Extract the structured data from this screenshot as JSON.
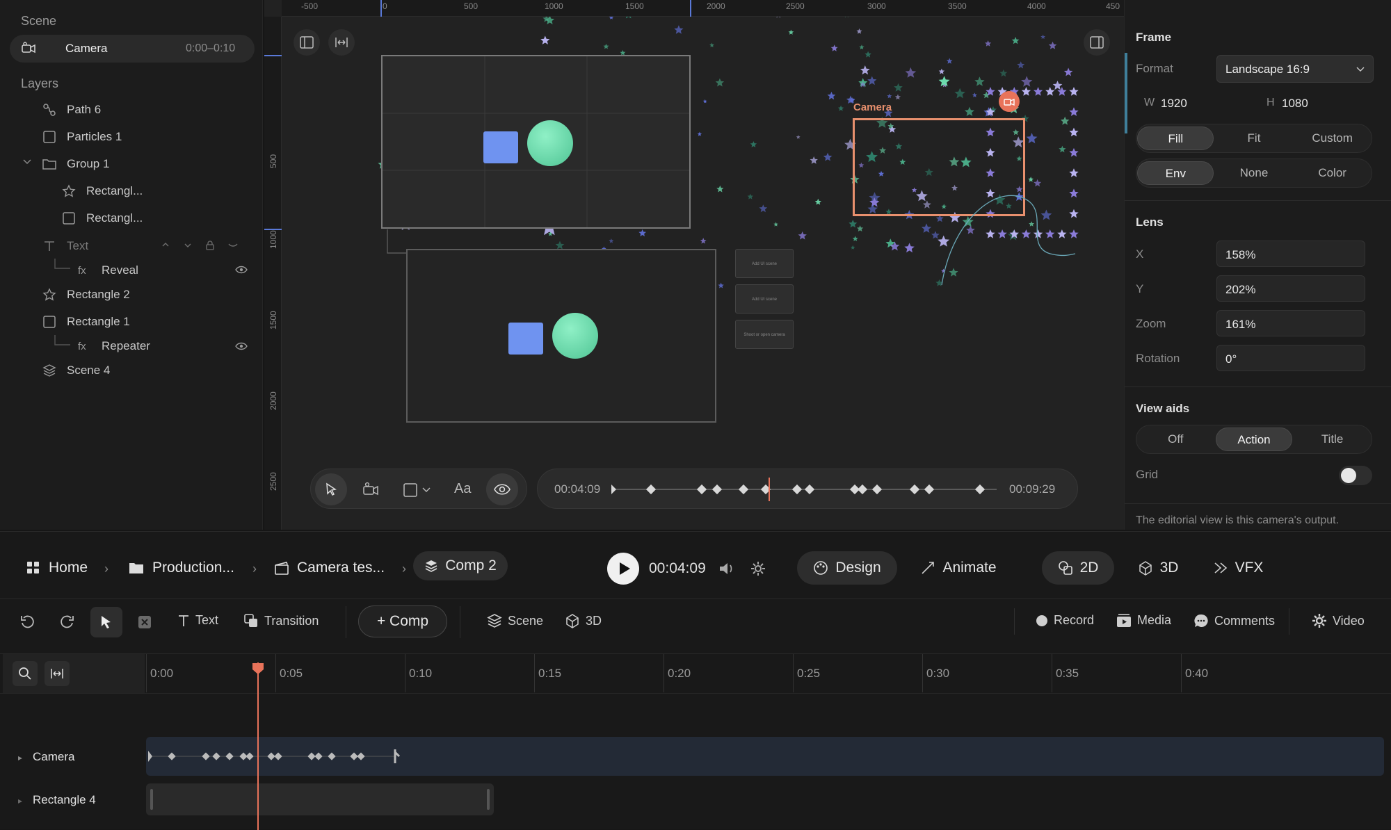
{
  "scene_panel": {
    "title": "Scene",
    "camera": {
      "label": "Camera",
      "range": "0:00–0:10"
    },
    "layers_title": "Layers",
    "layers": [
      {
        "label": "Path 6",
        "icon": "path-icon"
      },
      {
        "label": "Particles 1",
        "icon": "square-icon"
      },
      {
        "label": "Group 1",
        "icon": "folder-icon"
      },
      {
        "label": "Rectangl...",
        "icon": "star-icon"
      },
      {
        "label": "Rectangl...",
        "icon": "square-icon"
      },
      {
        "label": "Text",
        "icon": "text-icon"
      },
      {
        "label": "Reveal",
        "icon": "fx-icon"
      },
      {
        "label": "Rectangle 2",
        "icon": "star-icon"
      },
      {
        "label": "Rectangle 1",
        "icon": "square-icon"
      },
      {
        "label": "Repeater",
        "icon": "fx-icon"
      },
      {
        "label": "Scene 4",
        "icon": "stack-icon"
      }
    ],
    "fx_label": "fx"
  },
  "canvas": {
    "ruler_top": [
      "-500",
      "0",
      "500",
      "1000",
      "1500",
      "2000",
      "2500",
      "3000",
      "3500",
      "4000",
      "450"
    ],
    "ruler_left": [
      "500",
      "1000",
      "1500",
      "2000",
      "2500"
    ],
    "camera_label": "Camera",
    "thumb_text": [
      "Add UI scene",
      "Add UI scene",
      "Shoot or open camera"
    ],
    "playback": {
      "start": "00:04:09",
      "end": "00:09:29"
    }
  },
  "inspector": {
    "frame_title": "Frame",
    "format_label": "Format",
    "format_value": "Landscape 16:9",
    "w_label": "W",
    "w_value": "1920",
    "h_label": "H",
    "h_value": "1080",
    "fit_options": [
      "Fill",
      "Fit",
      "Custom"
    ],
    "fit_selected": "Fill",
    "bg_options": [
      "Env",
      "None",
      "Color"
    ],
    "bg_selected": "Env",
    "lens_title": "Lens",
    "x_label": "X",
    "x_value": "158%",
    "y_label": "Y",
    "y_value": "202%",
    "zoom_label": "Zoom",
    "zoom_value": "161%",
    "rotation_label": "Rotation",
    "rotation_value": "0°",
    "viewaids_title": "View aids",
    "view_options": [
      "Off",
      "Action",
      "Title"
    ],
    "view_selected": "Action",
    "grid_label": "Grid",
    "grid_on": false,
    "note": "The editorial view is this camera's output."
  },
  "breadcrumb": [
    "Home",
    "Production...",
    "Camera tes...",
    "Comp 2"
  ],
  "transport": {
    "time": "00:04:09"
  },
  "modes": {
    "design": "Design",
    "animate": "Animate",
    "d2": "2D",
    "d3": "3D",
    "vfx": "VFX"
  },
  "toolbar": {
    "text": "Text",
    "transition": "Transition",
    "comp": "+ Comp",
    "scene": "Scene",
    "threed": "3D",
    "record": "Record",
    "media": "Media",
    "comments": "Comments",
    "video": "Video"
  },
  "timeline": {
    "ticks": [
      "0:00",
      "0:05",
      "0:10",
      "0:15",
      "0:20",
      "0:25",
      "0:30",
      "0:35",
      "0:40"
    ],
    "tracks": [
      "Camera",
      "Rectangle 4"
    ],
    "playhead_seconds": 4.3
  },
  "colors": {
    "accent": "#e8735a",
    "mint": "#6fe3b2",
    "blue": "#6f93f0",
    "star_purple": "#8a7bd8"
  }
}
